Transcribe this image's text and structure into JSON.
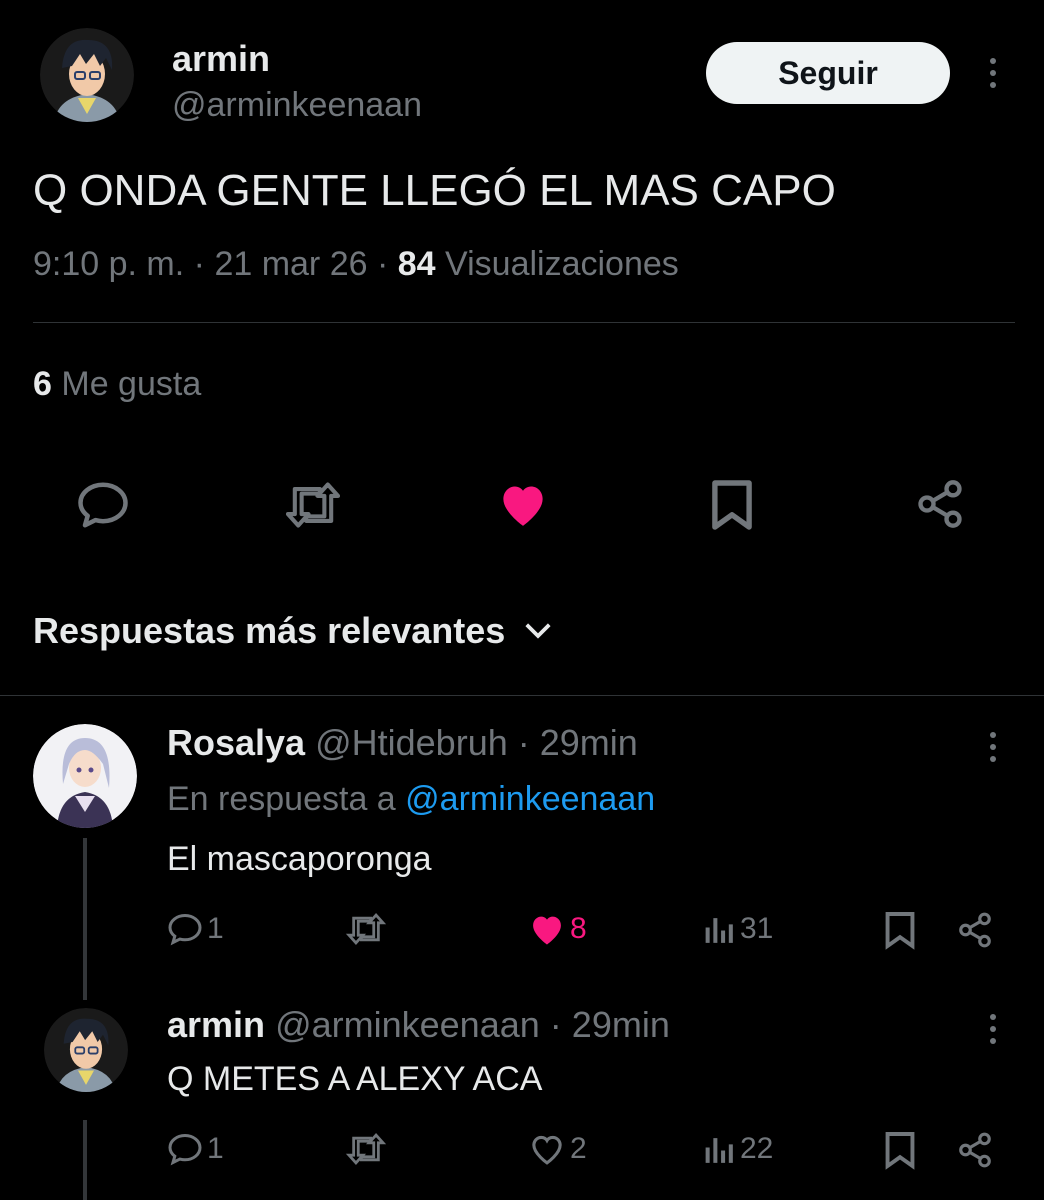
{
  "post": {
    "author_name": "armin",
    "author_handle": "@arminkeenaan",
    "follow_label": "Seguir",
    "text": "Q ONDA GENTE LLEGÓ EL MAS CAPO",
    "time": "9:10 p. m.",
    "date": "21 mar 26",
    "views_count": "84",
    "views_label": "Visualizaciones",
    "likes_count": "6",
    "likes_label": "Me gusta",
    "liked": true
  },
  "replies_sort": {
    "label": "Respuestas más relevantes"
  },
  "replies": [
    {
      "author_name": "Rosalya",
      "author_handle": "@Htidebruh",
      "time": "29min",
      "reply_to_prefix": "En respuesta a",
      "reply_to_handle": "@arminkeenaan",
      "text": "El mascaporonga",
      "reply_count": "1",
      "like_count": "8",
      "liked": true,
      "views": "31"
    },
    {
      "author_name": "armin",
      "author_handle": "@arminkeenaan",
      "time": "29min",
      "text": "Q METES A ALEXY ACA",
      "reply_count": "1",
      "like_count": "2",
      "liked": false,
      "views": "22"
    }
  ],
  "separator": "·",
  "colors": {
    "background": "#000000",
    "text": "#e7e9ea",
    "muted": "#71767b",
    "link": "#1d9bf0",
    "like": "#f91880",
    "button_bg": "#eff3f4"
  },
  "icons": [
    "reply-icon",
    "repost-icon",
    "heart-icon",
    "bookmark-icon",
    "share-icon",
    "views-icon",
    "more-icon",
    "chevron-down-icon"
  ]
}
